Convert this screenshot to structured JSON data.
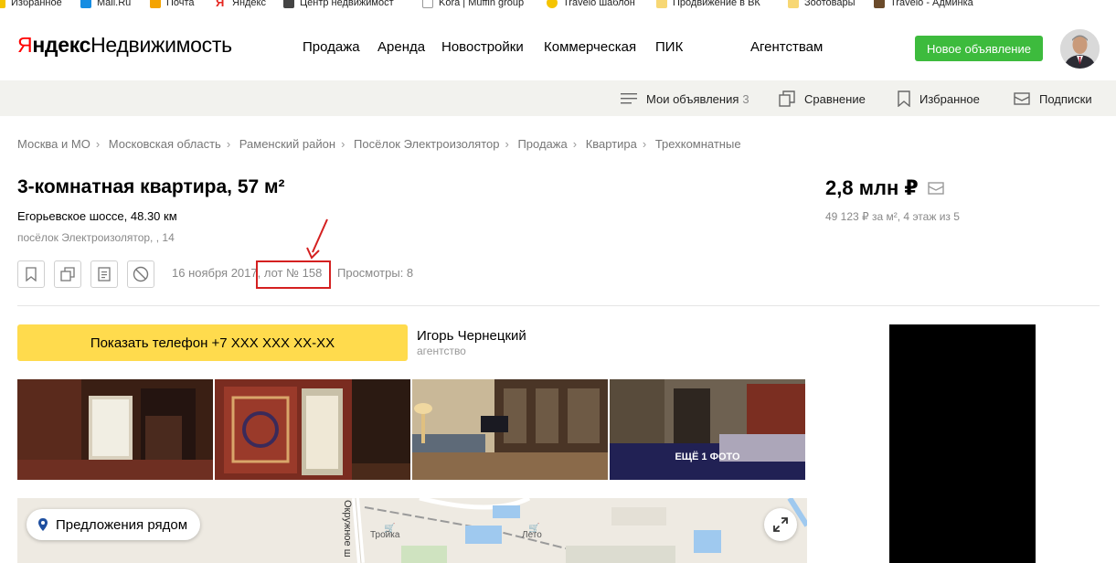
{
  "bookmarks": [
    {
      "label": "Избранное",
      "icon": "star-folder-icon",
      "color": "#f4c300"
    },
    {
      "label": "Mail.Ru",
      "icon": "mailru-icon",
      "color": "#168de2"
    },
    {
      "label": "Почта",
      "icon": "mail-envelope-icon",
      "color": "#f4a300"
    },
    {
      "label": "Яндекс",
      "icon": "yandex-icon",
      "color": "#e52620"
    },
    {
      "label": "Центр недвижимост",
      "icon": "house-icon",
      "color": "#444444"
    },
    {
      "label": "Kora | Muffin group",
      "icon": "page-icon",
      "color": "#bbbbbb"
    },
    {
      "label": "Travelo шаблон",
      "icon": "no-entry-icon",
      "color": "#f5c400"
    },
    {
      "label": "Продвижение в ВК",
      "icon": "folder-icon",
      "color": "#f7d774"
    },
    {
      "label": "Зоотовары",
      "icon": "folder-icon",
      "color": "#f7d774"
    },
    {
      "label": "Travelo - Админка",
      "icon": "site-icon",
      "color": "#6b4b2b"
    }
  ],
  "header": {
    "logo_y": "Я",
    "logo_ndex": "ндекс",
    "logo_service": "Недвижимость",
    "nav": [
      "Продажа",
      "Аренда",
      "Новостройки",
      "Коммерческая",
      "ПИК",
      "Агентствам"
    ],
    "new_ad_label": "Новое объявление",
    "brand_color": "#3dbb3d"
  },
  "subnav": {
    "my_ads_label": "Мои объявления",
    "my_ads_count": "3",
    "compare_label": "Сравнение",
    "favorites_label": "Избранное",
    "subscriptions_label": "Подписки"
  },
  "breadcrumbs": [
    "Москва и МО",
    "Московская область",
    "Раменский район",
    "Посёлок Электроизолятор",
    "Продажа",
    "Квартира",
    "Трехкомнатные"
  ],
  "listing": {
    "title": "3-комнатная квартира, 57 м²",
    "address_line1": "Егорьевское шоссе, 48.30 км",
    "address_line2": "посёлок Электроизолятор, , 14",
    "date_lot": "16 ноября 2017, лот № 158",
    "views": "Просмотры: 8",
    "price": "2,8 млн ₽",
    "price_details": "49 123 ₽ за м², 4 этаж из 5",
    "phone_button": "Показать телефон +7 XXX XXX XX-XX",
    "agent_name": "Игорь Чернецкий",
    "agent_type": "агентство",
    "more_photos": "ЕЩЁ 1 ФОТО",
    "accent_color": "#ffdb4d",
    "highlight_color": "#d42020"
  },
  "map": {
    "nearby_button": "Предложения рядом",
    "station_1": "Тройка",
    "station_2": "Лето",
    "street": "Окружное ш"
  }
}
